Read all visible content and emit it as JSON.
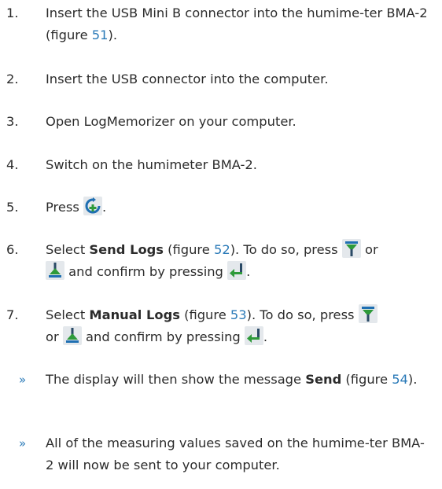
{
  "steps": [
    {
      "num": "1.",
      "before": "Insert the USB Mini B connector into the humime-ter BMA-2 (figure ",
      "fig": "51",
      "after": ")."
    },
    {
      "num": "2.",
      "text": "Insert the USB connector into the computer."
    },
    {
      "num": "3.",
      "text": "Open LogMemorizer on your computer."
    },
    {
      "num": "4.",
      "text": "Switch on the humimeter BMA-2."
    },
    {
      "num": "5.",
      "before": "Press ",
      "after": "."
    },
    {
      "num": "6.",
      "select": "Select ",
      "bold": "Send Logs",
      "fig_pre": " (figure ",
      "fig": "52",
      "fig_post": "). To do so, press ",
      "or": " or ",
      "confirm": " and confirm by pressing ",
      "end": "."
    },
    {
      "num": "7.",
      "select": "Select ",
      "bold": "Manual Logs",
      "fig_pre": " (figure ",
      "fig": "53",
      "fig_post": "). To do so, press ",
      "or": "or ",
      "confirm": " and confirm by pressing ",
      "end": "."
    }
  ],
  "results": [
    {
      "mark": "»",
      "before": "The display will then show the message ",
      "bold": "Send",
      "fig_pre": " (figure ",
      "fig": "54",
      "fig_post": ")."
    },
    {
      "mark": "»",
      "text": "All of the measuring values saved on the humime-ter BMA-2 will now be sent to your computer."
    }
  ],
  "colors": {
    "text": "#2b2b2b",
    "link": "#2a7ab8",
    "icon_bg": "#e4e8ec",
    "icon_blue": "#1f6fb2",
    "icon_green": "#2e9a3a",
    "icon_dark": "#2a4a66"
  },
  "icons": [
    "power-cycle-icon",
    "down-arrow-icon",
    "up-arrow-icon",
    "enter-icon"
  ]
}
